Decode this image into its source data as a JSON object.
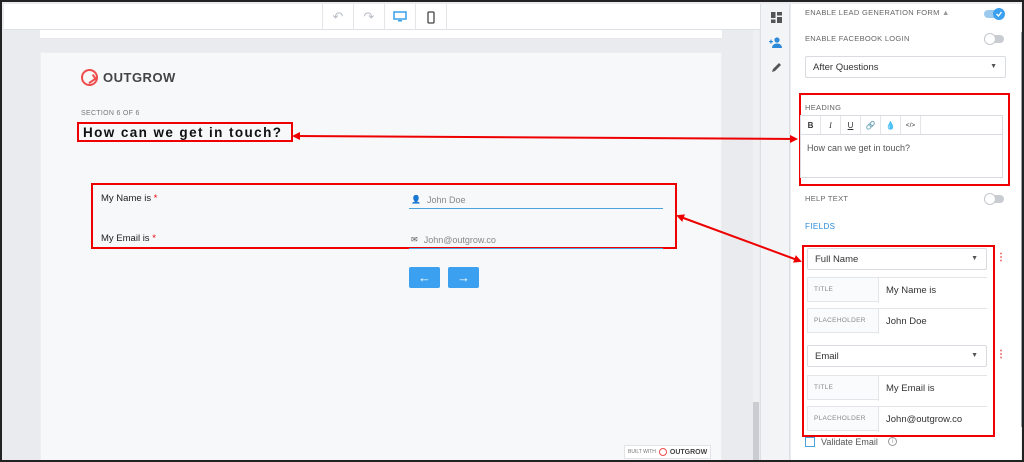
{
  "toolbar": {
    "buttons": [
      {
        "icon": "undo-icon",
        "glyph": "↶"
      },
      {
        "icon": "redo-icon",
        "glyph": "↷"
      },
      {
        "icon": "desktop-icon",
        "glyph": "🖥"
      },
      {
        "icon": "mobile-icon",
        "glyph": "▯"
      }
    ]
  },
  "page": {
    "logo_text": "OUTGROW",
    "section_label": "SECTION 6 OF 6",
    "heading": "How can we get in touch?",
    "fields": [
      {
        "label": "My Name is",
        "required_mark": "*",
        "icon_glyph": "👤",
        "placeholder": "John Doe"
      },
      {
        "label": "My Email is",
        "required_mark": "*",
        "icon_glyph": "✉",
        "placeholder": "John@outgrow.co"
      }
    ],
    "prev_glyph": "←",
    "next_glyph": "→",
    "built_with": "BUILT WITH",
    "built_brand": "OUTGROW"
  },
  "rail": {
    "icons": [
      {
        "name": "dashboard-icon",
        "glyph": "▦"
      },
      {
        "name": "add-user-icon",
        "glyph": "👥"
      },
      {
        "name": "edit-icon",
        "glyph": "✎"
      }
    ]
  },
  "panel": {
    "lead_gen_label": "ENABLE LEAD GENERATION FORM",
    "lead_gen_on": true,
    "facebook_label": "ENABLE FACEBOOK LOGIN",
    "facebook_on": false,
    "position_select": "After Questions",
    "heading_label": "HEADING",
    "rte_buttons": [
      "B",
      "I",
      "U",
      "🔗",
      "💧",
      "</>"
    ],
    "heading_value": "How can we get in touch?",
    "help_text_label": "HELP TEXT",
    "help_text_on": false,
    "fields_label": "FIELDS",
    "field_cards": [
      {
        "type": "Full Name",
        "title_label": "TITLE",
        "title_value": "My Name is",
        "placeholder_label": "PLACEHOLDER",
        "placeholder_value": "John Doe"
      },
      {
        "type": "Email",
        "title_label": "TITLE",
        "title_value": "My Email is",
        "placeholder_label": "PLACEHOLDER",
        "placeholder_value": "John@outgrow.co"
      }
    ],
    "validate_email_label": "Validate Email",
    "validate_email_checked": false
  },
  "colors": {
    "accent": "#3aa0ef",
    "annotation_red": "#e00000",
    "brand_red": "#ef4d4d"
  }
}
